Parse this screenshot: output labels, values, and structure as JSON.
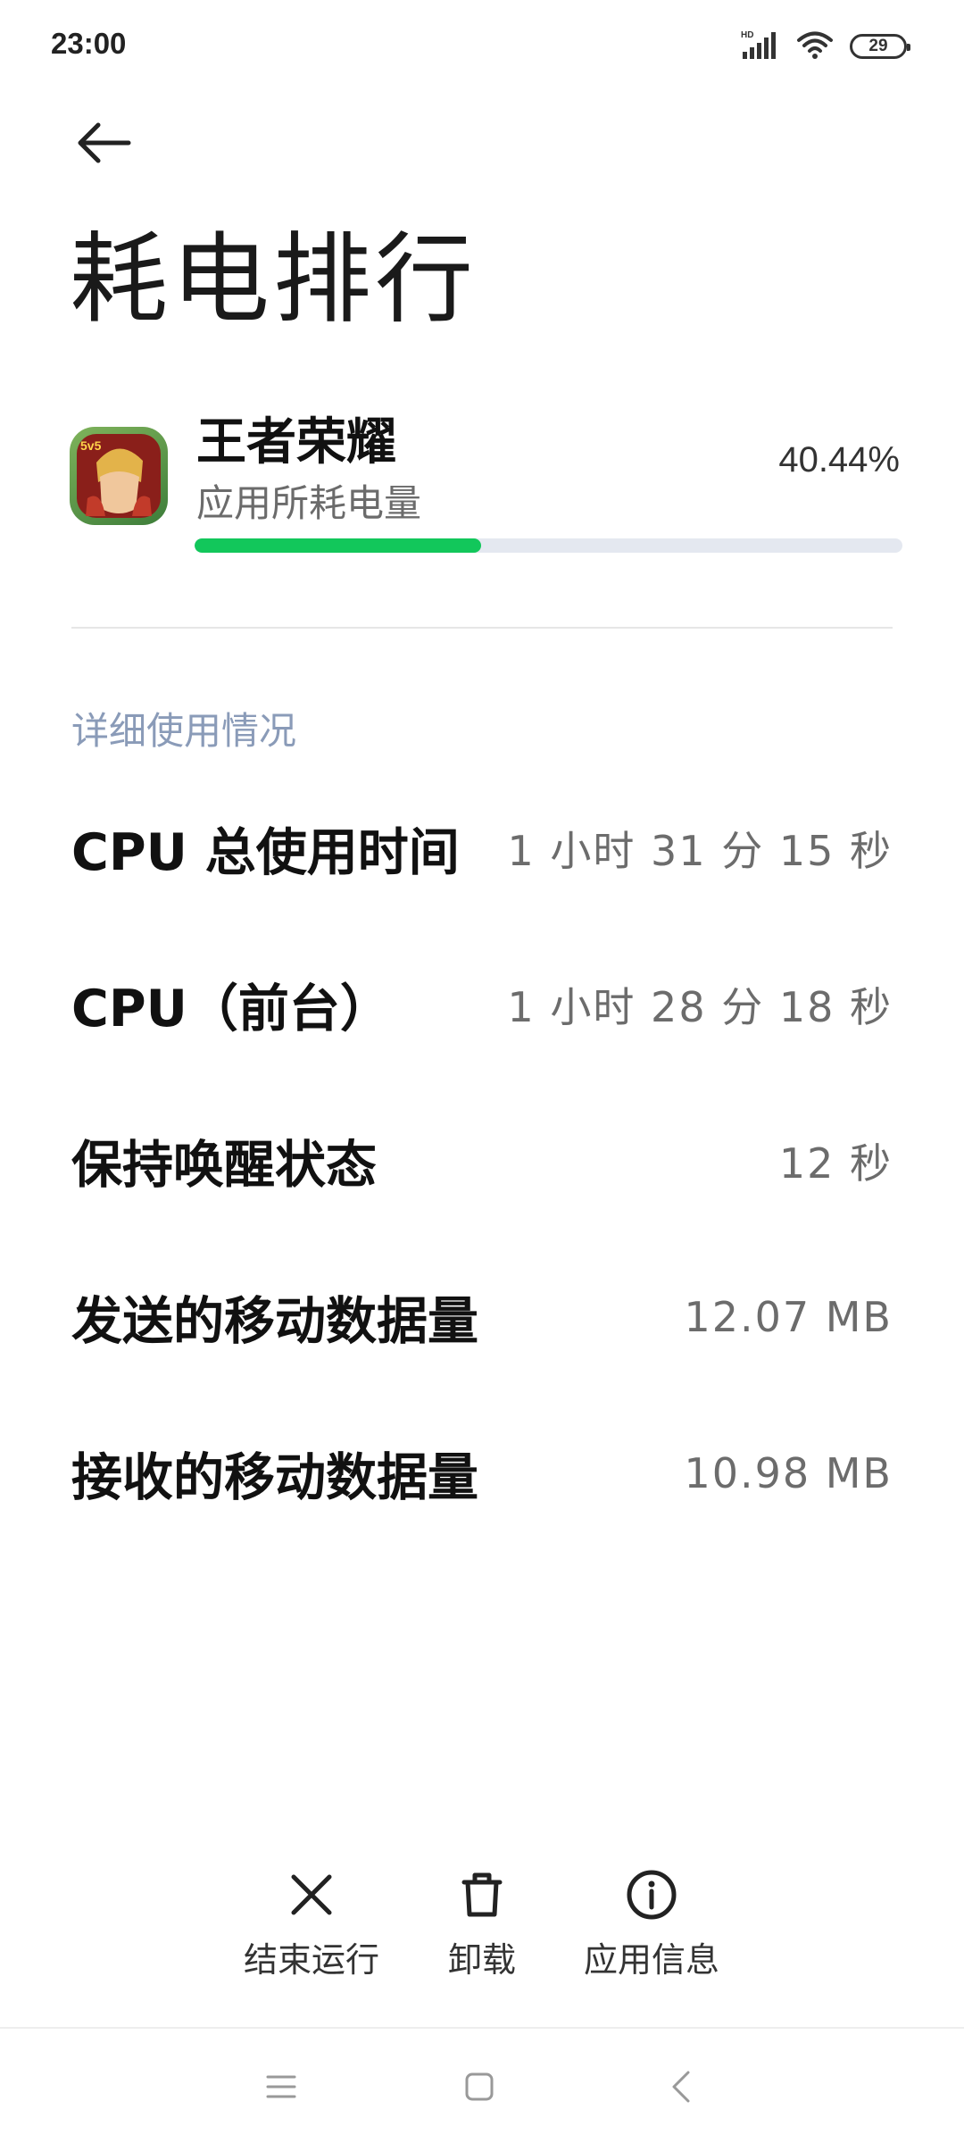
{
  "status_bar": {
    "time": "23:00",
    "network_label": "HD",
    "battery_level": "29",
    "icons": [
      "signal-icon",
      "wifi-icon",
      "battery-icon"
    ]
  },
  "header": {
    "back_icon": "back-arrow-icon",
    "title": "耗电排行"
  },
  "app": {
    "name": "王者荣耀",
    "subtitle": "应用所耗电量",
    "percent_text": "40.44%",
    "percent_value": 40.44,
    "bar_color": "#12c75b",
    "icon_badge": "5v5"
  },
  "details": {
    "section_title": "详细使用情况",
    "rows": [
      {
        "label": "CPU 总使用时间",
        "value": "1 小时 31 分 15 秒"
      },
      {
        "label": "CPU（前台）",
        "value": "1 小时 28 分 18 秒"
      },
      {
        "label": "保持唤醒状态",
        "value": "12 秒"
      },
      {
        "label": "发送的移动数据量",
        "value": "12.07 MB"
      },
      {
        "label": "接收的移动数据量",
        "value": "10.98 MB"
      }
    ]
  },
  "actions": [
    {
      "icon": "close-icon",
      "label": "结束运行"
    },
    {
      "icon": "trash-icon",
      "label": "卸载"
    },
    {
      "icon": "info-icon",
      "label": "应用信息"
    }
  ],
  "nav_bar": {
    "icons": [
      "menu-icon",
      "home-icon",
      "back-icon"
    ]
  }
}
